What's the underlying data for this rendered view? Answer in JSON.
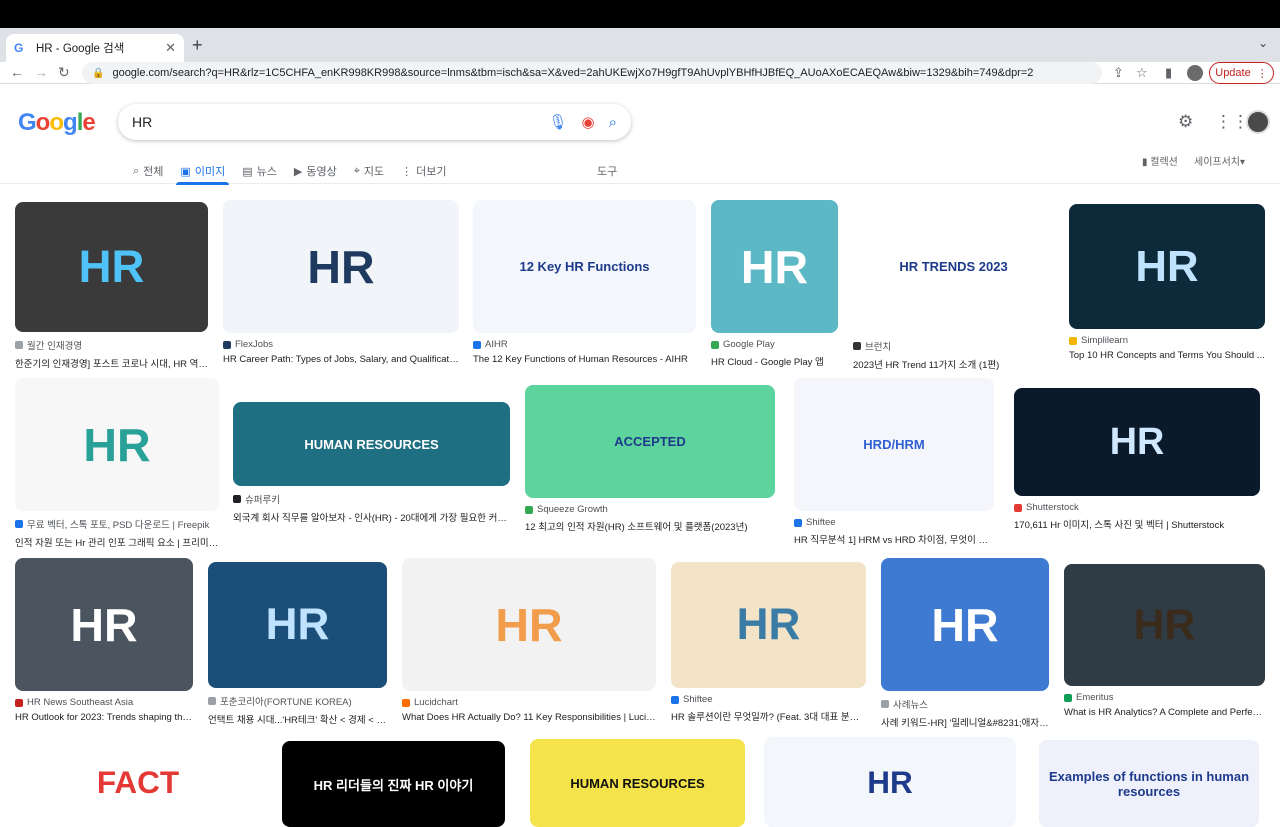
{
  "browser": {
    "tab_title": "HR - Google 검색",
    "url": "google.com/search?q=HR&rlz=1C5CHFA_enKR998KR998&source=lnms&tbm=isch&sa=X&ved=2ahUKEwjXo7H9gfT9AhUvplYBHfHJBfEQ_AUoAXoECAEQAw&biw=1329&bih=749&dpr=2",
    "update_label": "Update"
  },
  "google": {
    "logo": "Google",
    "query": "HR",
    "tabs": [
      "전체",
      "이미지",
      "뉴스",
      "동영상",
      "지도",
      "더보기"
    ],
    "tools": "도구",
    "collections": "컬렉션",
    "safesearch": "세이프서치"
  },
  "results": [
    {
      "source": "월간 인재경영",
      "caption": "한준기의 인재경영] 포스트 코로나 시대, HR 역할을 ...",
      "fav": "#9aa0a6",
      "bg": "#3a3a3a",
      "fg": "#4fc3f7",
      "text": "HR"
    },
    {
      "source": "FlexJobs",
      "caption": "HR Career Path: Types of Jobs, Salary, and Qualificatio...",
      "fav": "#1f3a5f",
      "bg": "#f1f4f8",
      "fg": "#1f3a5f",
      "text": "HR"
    },
    {
      "source": "AIHR",
      "caption": "The 12 Key Functions of Human Resources - AIHR",
      "fav": "#1a73e8",
      "bg": "#f3f6fb",
      "fg": "#1e3a8a",
      "text": "12 Key HR Functions"
    },
    {
      "source": "Google Play",
      "caption": "HR Cloud - Google Play 앱",
      "fav": "#34a853",
      "bg": "#5bb8c4",
      "fg": "#ffffff",
      "text": "HR"
    },
    {
      "source": "브런치",
      "caption": "2023년 HR Trend 11가지 소개 (1편)",
      "fav": "#333333",
      "bg": "#ffffff",
      "fg": "#1e3a8a",
      "text": "HR TRENDS 2023"
    },
    {
      "source": "Simplilearn",
      "caption": "Top 10 HR Concepts and Terms You Should ...",
      "fav": "#f4b400",
      "bg": "#0d2a3a",
      "fg": "#bfe3ff",
      "text": "HR"
    },
    {
      "source": "무료 벡터, 스톡 포토, PSD 다운로드 | Freepik",
      "caption": "인적 자원 또는 Hr 관리 인포 그래픽 요소 | 프리미엄 ...",
      "fav": "#1a73e8",
      "bg": "#f7f7f7",
      "fg": "#2aa198",
      "text": "HR"
    },
    {
      "source": "슈퍼루키",
      "caption": "외국계 회사 직무를 알아보자 - 인사(HR) - 20대에게 가장 필요한 커리어 정...",
      "fav": "#202124",
      "bg": "#1f6f82",
      "fg": "#ffffff",
      "text": "HUMAN RESOURCES"
    },
    {
      "source": "Squeeze Growth",
      "caption": "12 최고의 인적 자원(HR) 소프트웨어 및 플랫폼(2023년)",
      "fav": "#34a853",
      "bg": "#5dd39e",
      "fg": "#1e3a8a",
      "text": "ACCEPTED"
    },
    {
      "source": "Shiftee",
      "caption": "HR 직무분석 1] HRM vs HRD 차이점, 무엇이 다를...",
      "fav": "#1a73e8",
      "bg": "#f4f6fb",
      "fg": "#2f5fd0",
      "text": "HRD/HRM"
    },
    {
      "source": "Shutterstock",
      "caption": "170,611 Hr 이미지, 스톡 사진 및 벡터 | Shutterstock",
      "fav": "#e53935",
      "bg": "#0b1a2b",
      "fg": "#cfe8ff",
      "text": "HR"
    },
    {
      "source": "HR News Southeast Asia",
      "caption": "HR Outlook for 2023: Trends shaping the...",
      "fav": "#c5221f",
      "bg": "#4b5560",
      "fg": "#ffffff",
      "text": "HR"
    },
    {
      "source": "포춘코리아(FORTUNE KOREA)",
      "caption": "언택트 채용 시대...'HR테크' 확산 < 경제 < Indu...",
      "fav": "#9aa0a6",
      "bg": "#1b4f7a",
      "fg": "#bfe3ff",
      "text": "HR"
    },
    {
      "source": "Lucidchart",
      "caption": "What Does HR Actually Do? 11 Key Responsibilities | Lucid...",
      "fav": "#ff6d00",
      "bg": "#f2f2f2",
      "fg": "#f29d4b",
      "text": "HR"
    },
    {
      "source": "Shiftee",
      "caption": "HR 솔루션이란 무엇일까? (Feat. 3대 대표 분야 정...",
      "fav": "#1a73e8",
      "bg": "#f3e3c7",
      "fg": "#3a7ca5",
      "text": "HR"
    },
    {
      "source": "사례뉴스",
      "caption": "사례 키워드-HR] '밀레니얼&#8231;애자일...",
      "fav": "#9aa0a6",
      "bg": "#3e7ad1",
      "fg": "#ffffff",
      "text": "HR"
    },
    {
      "source": "Emeritus",
      "caption": "What is HR Analytics? A Complete and Perfect...",
      "fav": "#0f9d58",
      "bg": "#2f3b45",
      "fg": "#3a2b1a",
      "text": "HR"
    },
    {
      "source": "",
      "caption": "",
      "fav": "#ffffff",
      "bg": "#ffffff",
      "fg": "#e53935",
      "text": "FACT"
    },
    {
      "source": "",
      "caption": "",
      "fav": "#ffffff",
      "bg": "#000000",
      "fg": "#ffffff",
      "text": "HR 리더들의 진짜 HR 이야기"
    },
    {
      "source": "",
      "caption": "",
      "fav": "#ffffff",
      "bg": "#f4e34b",
      "fg": "#111111",
      "text": "HUMAN RESOURCES"
    },
    {
      "source": "",
      "caption": "",
      "fav": "#ffffff",
      "bg": "#f3f6fb",
      "fg": "#1e3a8a",
      "text": "HR"
    },
    {
      "source": "",
      "caption": "",
      "fav": "#ffffff",
      "bg": "#eef0fb",
      "fg": "#1e3a8a",
      "text": "Examples of functions in human resources"
    }
  ]
}
